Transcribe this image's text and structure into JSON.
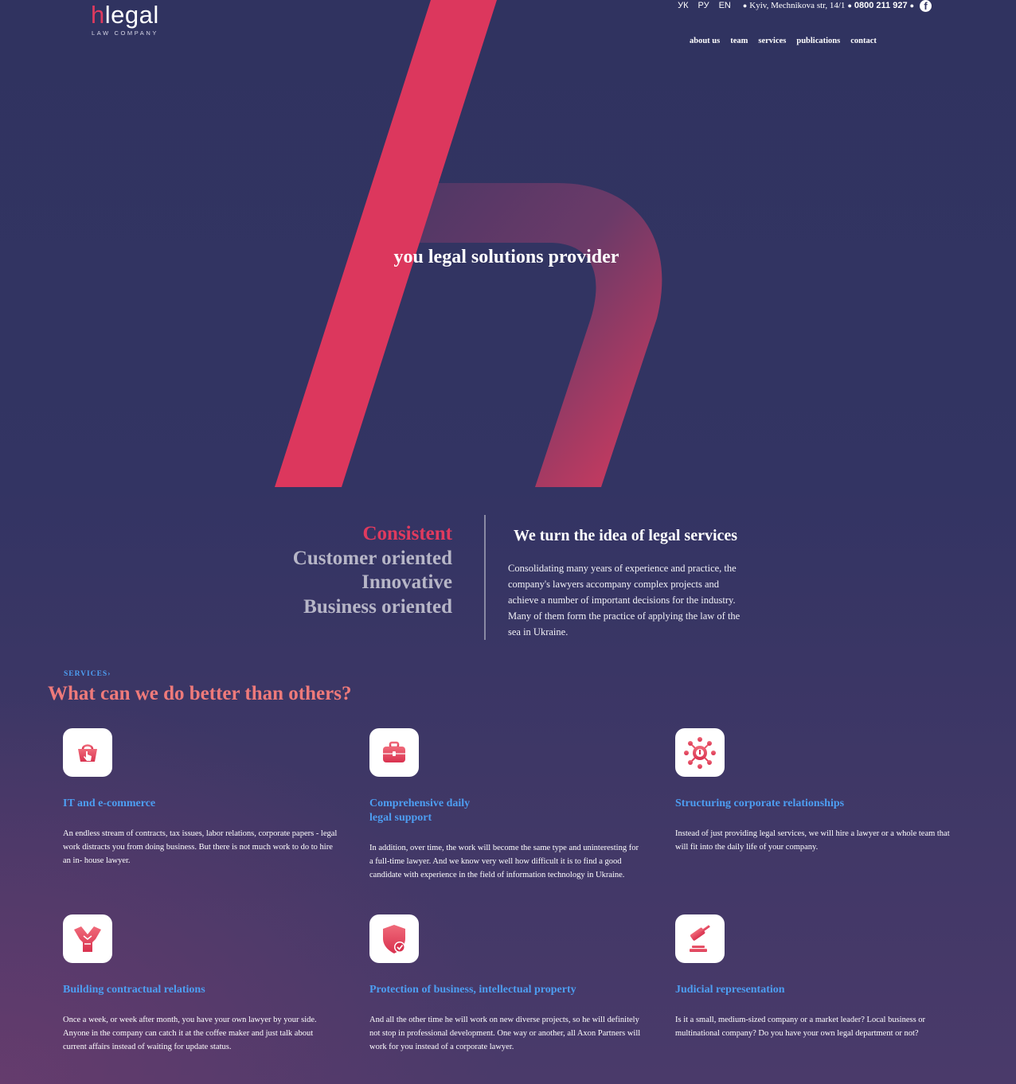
{
  "header": {
    "logo": {
      "mark": "h",
      "word": "legal",
      "subtitle": "LAW COMPANY"
    },
    "languages": [
      "УК",
      "РУ",
      "EN"
    ],
    "address": "Kyiv, Mechnikova str, 14/1",
    "phone": "0800 211 927",
    "social_icon": "facebook-icon",
    "nav": [
      "about us",
      "team",
      "services",
      "publications",
      "contact"
    ]
  },
  "hero": {
    "tagline": "you legal solutions provider"
  },
  "values": {
    "items": [
      "Consistent",
      "Customer oriented",
      "Innovative",
      "Business oriented"
    ],
    "active_index": 0
  },
  "about": {
    "title": "We turn the idea of legal services",
    "text": "Consolidating many years of experience and practice, the company's lawyers accompany complex projects and achieve a number of important decisions for the industry. Many of them form the practice of applying the law of the sea in Ukraine."
  },
  "services": {
    "kicker": "SERVICES",
    "title": "What can we do better than others?",
    "cards": [
      {
        "icon": "shopping-basket-icon",
        "title": "IT and e-commerce",
        "text": "An endless stream of contracts, tax issues, labor relations, corporate papers - legal work distracts you from doing business. But there is not much work to do to hire an in- house lawyer."
      },
      {
        "icon": "briefcase-icon",
        "title_line1": "Comprehensive daily",
        "title_line2": "legal support",
        "text": "In addition, over time, the work will become the same type and uninteresting for a full-time lawyer. And we know very well how difficult it is to find a good candidate with experience in the field of information technology in Ukraine."
      },
      {
        "icon": "network-icon",
        "title": "Structuring corporate relationships",
        "text": "Instead of just providing legal services, we will hire a lawyer or a whole team that will fit into the daily life of your company."
      },
      {
        "icon": "handshake-icon",
        "title": "Building contractual relations",
        "text": "Once a week, or week after month, you have your own lawyer by your side. Anyone in the company can catch it at the coffee maker and just talk about current affairs instead of waiting for update status."
      },
      {
        "icon": "shield-check-icon",
        "title": "Protection of business, intellectual property",
        "text": "And all the other time he will work on new diverse projects, so he will definitely not stop in professional development. One way or another, all Axon Partners will work for you instead of a corporate lawyer."
      },
      {
        "icon": "gavel-icon",
        "title": "Judicial representation",
        "text": "Is it a small, medium-sized company or a market leader? Local business or multinational company? Do you have your own legal department or not?"
      }
    ]
  },
  "colors": {
    "background": "#313361",
    "accent": "#e03a5e",
    "link_blue": "#4d9ef2",
    "heading_coral": "#ef7a7a",
    "muted_text": "#b7b6c7"
  }
}
